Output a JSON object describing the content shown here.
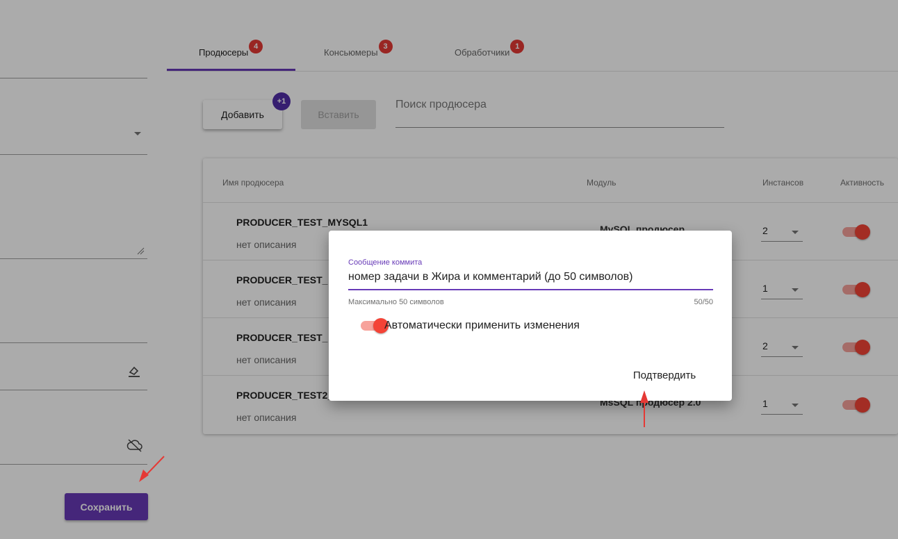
{
  "left_panel": {
    "save_label": "Сохранить"
  },
  "tabs": [
    {
      "label": "Продюсеры",
      "badge": "4"
    },
    {
      "label": "Консьюмеры",
      "badge": "3"
    },
    {
      "label": "Обработчики",
      "badge": "1"
    }
  ],
  "toolbar": {
    "add_label": "Добавить",
    "add_badge": "+1",
    "paste_label": "Вставить",
    "search_placeholder": "Поиск продюсера"
  },
  "table": {
    "headers": {
      "name": "Имя продюсера",
      "module": "Модуль",
      "instances": "Инстансов",
      "active": "Активность"
    },
    "rows": [
      {
        "name": "PRODUCER_TEST_MYSQL1",
        "desc": "нет описания",
        "module": "MySQL продюсер",
        "instances": "2",
        "active": true
      },
      {
        "name": "PRODUCER_TEST_",
        "desc": "нет описания",
        "module": "",
        "instances": "1",
        "active": true
      },
      {
        "name": "PRODUCER_TEST_",
        "desc": "нет описания",
        "module": "",
        "instances": "2",
        "active": true
      },
      {
        "name": "PRODUCER_TEST2_",
        "desc": "нет описания",
        "module": "MsSQL продюсер 2.0",
        "instances": "1",
        "active": true
      }
    ]
  },
  "dialog": {
    "label": "Сообщение коммита",
    "value": "номер задачи в Жира и комментарий (до 50 символов)",
    "hint": "Максимально 50 символов",
    "counter": "50/50",
    "auto_apply_label": "Автоматически применить изменения",
    "auto_apply_on": true,
    "confirm_label": "Подтвердить"
  },
  "colors": {
    "primary": "#673ab7",
    "badge": "#e53935",
    "toggle": "#f44336",
    "annotation": "#e53935"
  }
}
